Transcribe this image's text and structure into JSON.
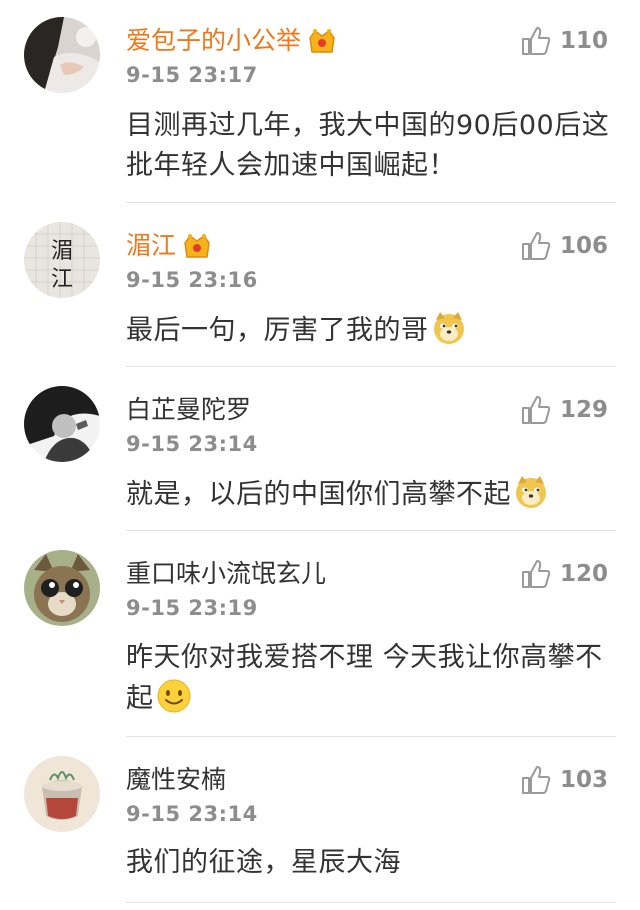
{
  "comments": [
    {
      "username": "爱包子的小公举",
      "time": "9-15 23:17",
      "likes": "110",
      "text": "目测再过几年，我大中国的90后00后这批年轻人会加速中国崛起！",
      "vip": true,
      "emoji": ""
    },
    {
      "username": "湄江",
      "time": "9-15 23:16",
      "likes": "106",
      "text": "最后一句，厉害了我的哥",
      "vip": true,
      "emoji": "doge-emoji"
    },
    {
      "username": "白芷曼陀罗",
      "time": "9-15 23:14",
      "likes": "129",
      "text": "就是，以后的中国你们高攀不起",
      "vip": false,
      "emoji": "doge-emoji"
    },
    {
      "username": "重口味小流氓玄儿",
      "time": "9-15 23:19",
      "likes": "120",
      "text": "昨天你对我爱搭不理 今天我让你高攀不起",
      "vip": false,
      "emoji": "smile-emoji"
    },
    {
      "username": "魔性安楠",
      "time": "9-15 23:14",
      "likes": "103",
      "text": "我们的征途，星辰大海",
      "vip": false,
      "emoji": ""
    }
  ],
  "avatar_calligraphy": "湄江",
  "colors": {
    "vip_name": "#f07818",
    "name": "#333333",
    "meta": "#8d8d8d",
    "divider": "#e3e3e3"
  }
}
